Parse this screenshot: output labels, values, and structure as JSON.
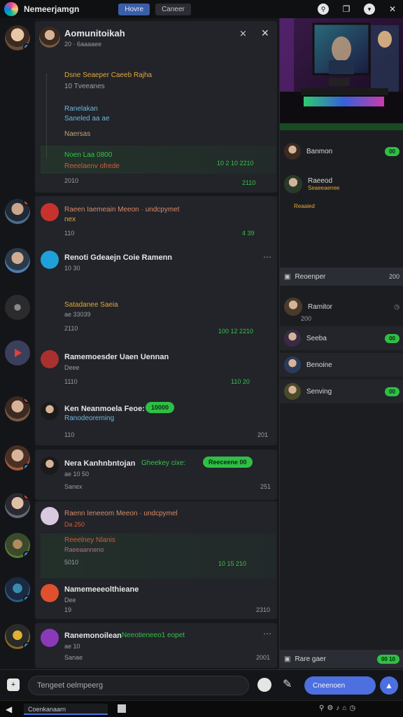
{
  "topbar": {
    "app_title": "Nemeerjamgn",
    "tabs": [
      "Hovre",
      "Caneer"
    ],
    "active_tab": 0
  },
  "header": {
    "channel_name": "Aomunitoikah",
    "channel_sub": "20 · 6aaaaee"
  },
  "messages": {
    "m1": {
      "l1": "Dsne Seaeper Caeeb Rajha",
      "l2": "10 Tveeanes",
      "l3": "Ranelakan",
      "l4": "Saneled aa ae",
      "l5": "Naersas",
      "l6": "Noen Laa 0800",
      "l7": "Reeelaenv ofrede",
      "time1": "10 2 10 2210",
      "time2": "2110",
      "time3": "2010"
    },
    "m2": {
      "line": "Raeen Iaemeain Meeon · undcpymet",
      "sub": "nex",
      "count": "110",
      "time": "4 39"
    },
    "m3": {
      "title": "Renoti Gdeaejn Coie Ramenn",
      "sub": "10 30",
      "name2": "Satadanee Saeia",
      "sub2": "ae 33039",
      "count2": "2110",
      "time2": "100 12 2210",
      "name3": "Ramemoesder Uaen Uennan",
      "sub3": "Deee",
      "count3": "1110",
      "time3": "110 20"
    },
    "m4": {
      "title": "Ken Neanmoela Feoe:",
      "pill": "10000",
      "sub": "Ranodeoreming",
      "count": "110",
      "time": "201"
    },
    "m5": {
      "title": "Nera Kanhnbntojan",
      "green": "Gheekey cixe:",
      "pill": "Reeceene 00",
      "sub": "ae 10 50",
      "count": "Sanex",
      "time": "251"
    },
    "m6": {
      "title": "Raenn Ieneeom Meeon · undcpymel",
      "sub": "Da 250",
      "name2": "Reeelney Nlanis",
      "sub2": "Raeeaanneno",
      "count2": "5010",
      "time2": "10 15 210"
    },
    "m7": {
      "title": "Namemeeeolthieane",
      "sub": "Dee",
      "count": "19",
      "time": "2310"
    },
    "m8": {
      "title": "Ranemonoilean",
      "green": "Neeotieneeo1 eopet",
      "sub": "ae 10",
      "count": "Sanae",
      "time": "2001"
    }
  },
  "right": {
    "items": [
      {
        "name": "Banmon",
        "pill": "00"
      },
      {
        "name": "Raeeod",
        "sub": "Seaeeaenee",
        "sub2": "Reaaied"
      },
      {
        "name": "Reoenper",
        "time": "200"
      },
      {
        "name": "Ramitor",
        "sub": "200"
      },
      {
        "name": "Seeba",
        "pill": "00"
      },
      {
        "name": "Benoine"
      },
      {
        "name": "Senving",
        "pill": "00"
      }
    ],
    "footer": {
      "label": "Rare gaer",
      "pill": "00 10"
    }
  },
  "composer": {
    "placeholder": "Tengeet oelmpeerg",
    "send_label": "Cneenoen"
  },
  "taskbar": {
    "app": "Coenkanaarn"
  },
  "colors": {
    "accent": "#4d6fe0",
    "green": "#2fbf45",
    "background": "#17181b"
  }
}
